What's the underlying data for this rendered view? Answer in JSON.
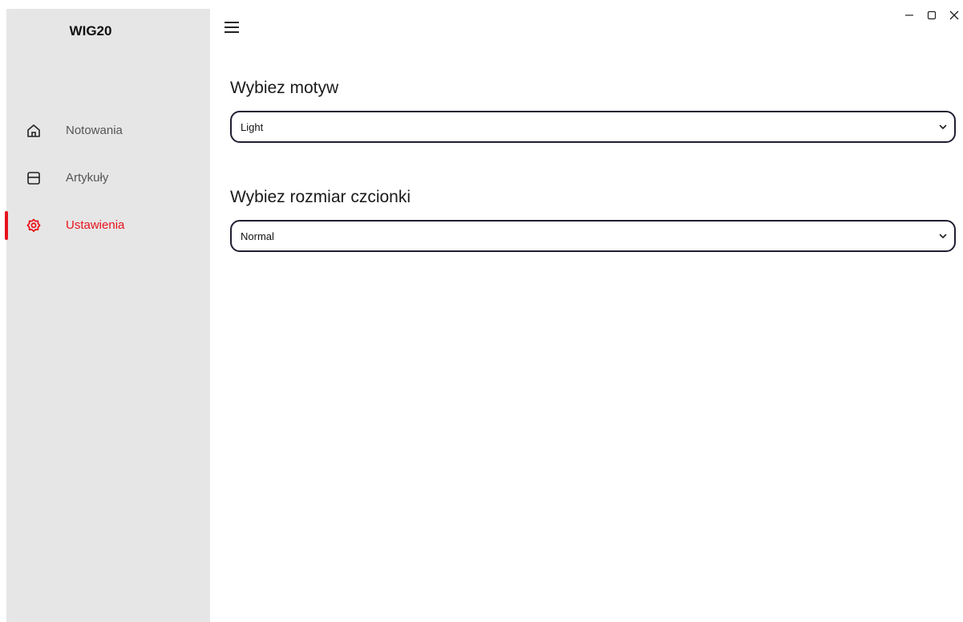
{
  "sidebar": {
    "app_title": "WIG20",
    "items": [
      {
        "label": "Notowania",
        "icon": "home-icon",
        "active": false
      },
      {
        "label": "Artykuły",
        "icon": "article-icon",
        "active": false
      },
      {
        "label": "Ustawienia",
        "icon": "settings-icon",
        "active": true
      }
    ]
  },
  "settings": {
    "theme": {
      "title": "Wybiez motyw",
      "value": "Light"
    },
    "font_size": {
      "title": "Wybiez rozmiar czcionki",
      "value": "Normal"
    }
  },
  "colors": {
    "accent": "#e8121b",
    "sidebar_bg": "#e6e6e6",
    "select_border": "#1f1f33"
  }
}
